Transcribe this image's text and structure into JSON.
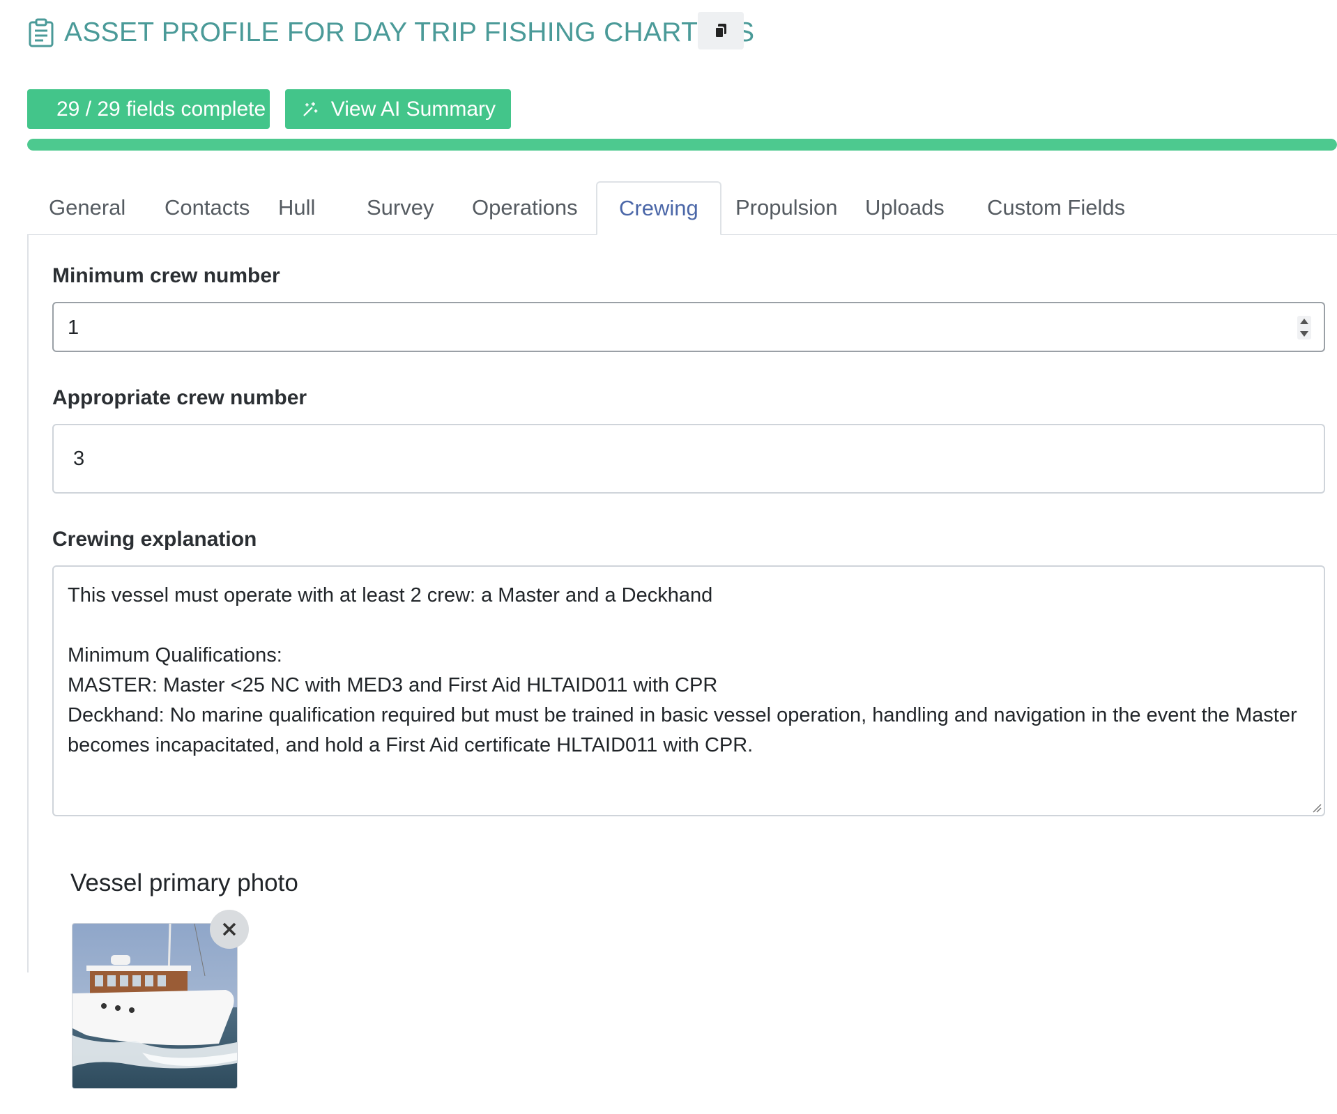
{
  "page": {
    "title": "ASSET PROFILE FOR DAY TRIP FISHING CHARTERS",
    "title_icon": "clipboard-icon",
    "copy_icon": "copy-icon"
  },
  "actions": {
    "fields_complete_label": "29 / 29 fields complete",
    "fields_complete_icon": "checklist-icon",
    "ai_summary_label": "View AI Summary",
    "ai_summary_icon": "magic-wand-icon",
    "accent_color": "#43c58a"
  },
  "progress": {
    "percent": 100,
    "color": "#4dc98f"
  },
  "tabs": [
    {
      "label": "General"
    },
    {
      "label": "Contacts"
    },
    {
      "label": "Hull"
    },
    {
      "label": "Survey"
    },
    {
      "label": "Operations"
    },
    {
      "label": "Crewing",
      "active": true
    },
    {
      "label": "Propulsion"
    },
    {
      "label": "Uploads"
    },
    {
      "label": "Custom Fields"
    }
  ],
  "form": {
    "min_crew": {
      "label": "Minimum crew number",
      "value": "1"
    },
    "appropriate_crew": {
      "label": "Appropriate crew number",
      "value": "3"
    },
    "crewing_explanation": {
      "label": "Crewing explanation",
      "value": "This vessel must operate with at least 2 crew: a Master and a Deckhand\n\nMinimum Qualifications:\nMASTER: Master <25 NC with MED3 and First Aid HLTAID011 with CPR\nDeckhand: No marine qualification required but must be trained in basic vessel operation, handling and navigation in the event the Master becomes incapacitated, and hold a First Aid certificate HLTAID011 with CPR."
    }
  },
  "photo": {
    "label": "Vessel primary photo",
    "remove_icon": "close-icon"
  }
}
